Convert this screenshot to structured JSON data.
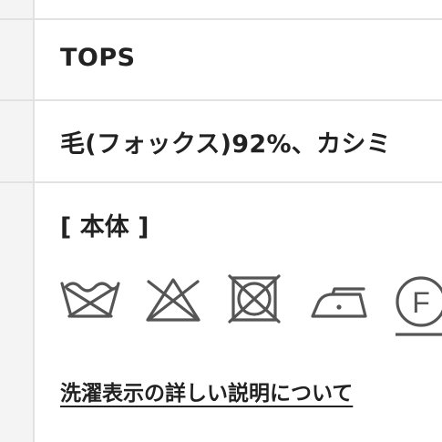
{
  "category": {
    "value": "TOPS"
  },
  "material": {
    "value": "毛(フォックス)92%、カシミ"
  },
  "care": {
    "section_label": "[ 本体 ]",
    "icons": [
      "hand-wash-icon",
      "no-bleach-icon",
      "no-tumble-dry-icon",
      "low-iron-icon",
      "dry-clean-f-icon"
    ],
    "dry_clean_letter": "F",
    "link_label": "洗濯表示の詳しい説明について"
  },
  "colors": {
    "border": "#e2e2e2",
    "header_bg": "#f4f4f4",
    "text": "#222222",
    "icon": "#555555"
  }
}
